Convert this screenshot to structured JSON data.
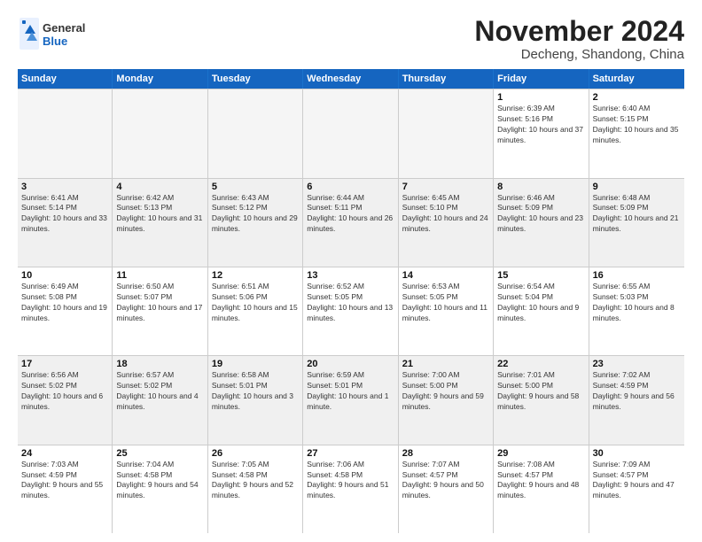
{
  "logo": {
    "line1": "General",
    "line2": "Blue"
  },
  "title": "November 2024",
  "location": "Decheng, Shandong, China",
  "days_of_week": [
    "Sunday",
    "Monday",
    "Tuesday",
    "Wednesday",
    "Thursday",
    "Friday",
    "Saturday"
  ],
  "weeks": [
    [
      {
        "day": "",
        "empty": true
      },
      {
        "day": "",
        "empty": true
      },
      {
        "day": "",
        "empty": true
      },
      {
        "day": "",
        "empty": true
      },
      {
        "day": "",
        "empty": true
      },
      {
        "day": "1",
        "sunrise": "6:39 AM",
        "sunset": "5:16 PM",
        "daylight": "10 hours and 37 minutes."
      },
      {
        "day": "2",
        "sunrise": "6:40 AM",
        "sunset": "5:15 PM",
        "daylight": "10 hours and 35 minutes."
      }
    ],
    [
      {
        "day": "3",
        "sunrise": "6:41 AM",
        "sunset": "5:14 PM",
        "daylight": "10 hours and 33 minutes."
      },
      {
        "day": "4",
        "sunrise": "6:42 AM",
        "sunset": "5:13 PM",
        "daylight": "10 hours and 31 minutes."
      },
      {
        "day": "5",
        "sunrise": "6:43 AM",
        "sunset": "5:12 PM",
        "daylight": "10 hours and 29 minutes."
      },
      {
        "day": "6",
        "sunrise": "6:44 AM",
        "sunset": "5:11 PM",
        "daylight": "10 hours and 26 minutes."
      },
      {
        "day": "7",
        "sunrise": "6:45 AM",
        "sunset": "5:10 PM",
        "daylight": "10 hours and 24 minutes."
      },
      {
        "day": "8",
        "sunrise": "6:46 AM",
        "sunset": "5:09 PM",
        "daylight": "10 hours and 23 minutes."
      },
      {
        "day": "9",
        "sunrise": "6:48 AM",
        "sunset": "5:09 PM",
        "daylight": "10 hours and 21 minutes."
      }
    ],
    [
      {
        "day": "10",
        "sunrise": "6:49 AM",
        "sunset": "5:08 PM",
        "daylight": "10 hours and 19 minutes."
      },
      {
        "day": "11",
        "sunrise": "6:50 AM",
        "sunset": "5:07 PM",
        "daylight": "10 hours and 17 minutes."
      },
      {
        "day": "12",
        "sunrise": "6:51 AM",
        "sunset": "5:06 PM",
        "daylight": "10 hours and 15 minutes."
      },
      {
        "day": "13",
        "sunrise": "6:52 AM",
        "sunset": "5:05 PM",
        "daylight": "10 hours and 13 minutes."
      },
      {
        "day": "14",
        "sunrise": "6:53 AM",
        "sunset": "5:05 PM",
        "daylight": "10 hours and 11 minutes."
      },
      {
        "day": "15",
        "sunrise": "6:54 AM",
        "sunset": "5:04 PM",
        "daylight": "10 hours and 9 minutes."
      },
      {
        "day": "16",
        "sunrise": "6:55 AM",
        "sunset": "5:03 PM",
        "daylight": "10 hours and 8 minutes."
      }
    ],
    [
      {
        "day": "17",
        "sunrise": "6:56 AM",
        "sunset": "5:02 PM",
        "daylight": "10 hours and 6 minutes."
      },
      {
        "day": "18",
        "sunrise": "6:57 AM",
        "sunset": "5:02 PM",
        "daylight": "10 hours and 4 minutes."
      },
      {
        "day": "19",
        "sunrise": "6:58 AM",
        "sunset": "5:01 PM",
        "daylight": "10 hours and 3 minutes."
      },
      {
        "day": "20",
        "sunrise": "6:59 AM",
        "sunset": "5:01 PM",
        "daylight": "10 hours and 1 minute."
      },
      {
        "day": "21",
        "sunrise": "7:00 AM",
        "sunset": "5:00 PM",
        "daylight": "9 hours and 59 minutes."
      },
      {
        "day": "22",
        "sunrise": "7:01 AM",
        "sunset": "5:00 PM",
        "daylight": "9 hours and 58 minutes."
      },
      {
        "day": "23",
        "sunrise": "7:02 AM",
        "sunset": "4:59 PM",
        "daylight": "9 hours and 56 minutes."
      }
    ],
    [
      {
        "day": "24",
        "sunrise": "7:03 AM",
        "sunset": "4:59 PM",
        "daylight": "9 hours and 55 minutes."
      },
      {
        "day": "25",
        "sunrise": "7:04 AM",
        "sunset": "4:58 PM",
        "daylight": "9 hours and 54 minutes."
      },
      {
        "day": "26",
        "sunrise": "7:05 AM",
        "sunset": "4:58 PM",
        "daylight": "9 hours and 52 minutes."
      },
      {
        "day": "27",
        "sunrise": "7:06 AM",
        "sunset": "4:58 PM",
        "daylight": "9 hours and 51 minutes."
      },
      {
        "day": "28",
        "sunrise": "7:07 AM",
        "sunset": "4:57 PM",
        "daylight": "9 hours and 50 minutes."
      },
      {
        "day": "29",
        "sunrise": "7:08 AM",
        "sunset": "4:57 PM",
        "daylight": "9 hours and 48 minutes."
      },
      {
        "day": "30",
        "sunrise": "7:09 AM",
        "sunset": "4:57 PM",
        "daylight": "9 hours and 47 minutes."
      }
    ]
  ]
}
